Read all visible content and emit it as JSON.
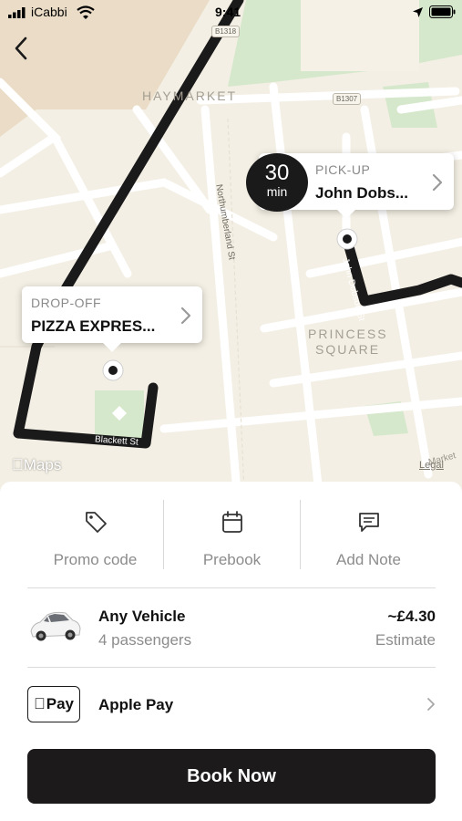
{
  "status_bar": {
    "carrier": "iCabbi",
    "time": "9:41"
  },
  "map": {
    "areas": {
      "haymarket": "HAYMARKET",
      "princess_square_1": "PRINCESS",
      "princess_square_2": "SQUARE"
    },
    "streets": {
      "northumberland": "Northumberland St",
      "blackett": "Blackett St",
      "dobson": "John Dobson St",
      "market": "Market"
    },
    "road_badges": {
      "b1318": "B1318",
      "b1307": "B1307"
    },
    "attribution": "Maps",
    "legal": "Legal"
  },
  "pickup": {
    "kind": "PICK-UP",
    "name": "John Dobs...",
    "eta_value": "30",
    "eta_unit": "min"
  },
  "dropoff": {
    "kind": "DROP-OFF",
    "name": "PIZZA EXPRES..."
  },
  "options": [
    {
      "label": "Promo code",
      "icon": "tag-icon"
    },
    {
      "label": "Prebook",
      "icon": "calendar-icon"
    },
    {
      "label": "Add Note",
      "icon": "message-icon"
    }
  ],
  "vehicle": {
    "name": "Any Vehicle",
    "capacity": "4 passengers",
    "price": "~£4.30",
    "price_note": "Estimate"
  },
  "payment": {
    "badge": "Pay",
    "label": "Apple Pay"
  },
  "book_button": "Book Now",
  "colors": {
    "route": "#1b1a1a",
    "map_bg": "#f3efe4",
    "park": "#d7ebcd",
    "button": "#1c1a1a"
  }
}
